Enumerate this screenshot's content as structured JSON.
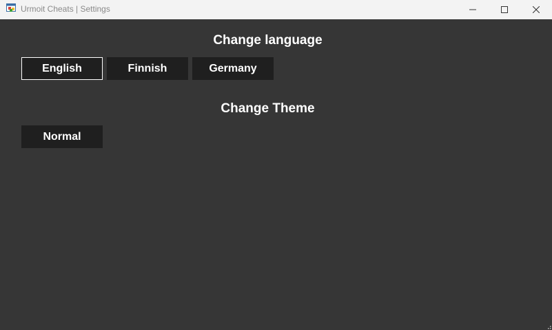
{
  "window": {
    "title": "Urmoit Cheats | Settings",
    "icon": "app-window-icon"
  },
  "language_section": {
    "heading": "Change language",
    "options": [
      {
        "label": "English",
        "selected": true
      },
      {
        "label": "Finnish",
        "selected": false
      },
      {
        "label": "Germany",
        "selected": false
      }
    ]
  },
  "theme_section": {
    "heading": "Change Theme",
    "options": [
      {
        "label": "Normal",
        "selected": false
      }
    ]
  },
  "colors": {
    "background": "#363636",
    "button": "#1f1f1f",
    "text": "#ffffff",
    "titlebar": "#f3f3f3"
  }
}
